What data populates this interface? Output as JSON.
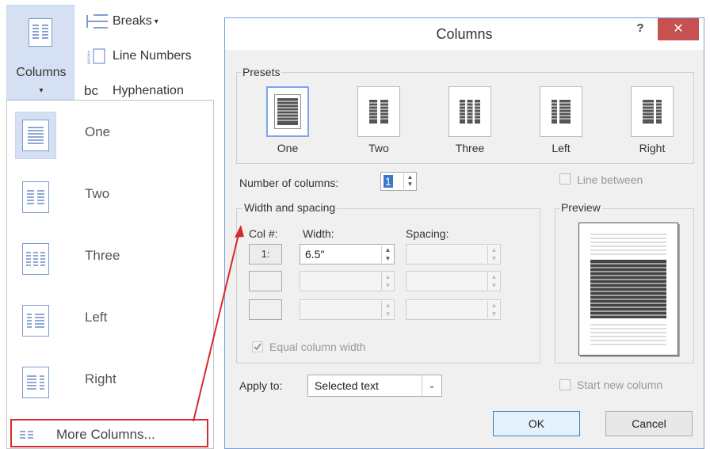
{
  "ribbon": {
    "columns_label": "Columns",
    "columns_arrow": "▾",
    "breaks_label": "Breaks",
    "breaks_arrow": "▾",
    "line_numbers_label": "Line Numbers",
    "hyphenation_label": "Hyphenation",
    "hyphenation_icon_text": "bc"
  },
  "dropdown": {
    "items": [
      {
        "label": "One"
      },
      {
        "label": "Two"
      },
      {
        "label": "Three"
      },
      {
        "label": "Left"
      },
      {
        "label": "Right"
      }
    ],
    "more_columns_label": "More Columns..."
  },
  "dialog": {
    "title": "Columns",
    "help_label": "?",
    "close_label": "✕",
    "presets_label": "Presets",
    "presets": [
      {
        "label": "One"
      },
      {
        "label": "Two"
      },
      {
        "label": "Three"
      },
      {
        "label": "Left"
      },
      {
        "label": "Right"
      }
    ],
    "number_of_columns_label": "Number of columns:",
    "number_of_columns_value": "1",
    "line_between_label": "Line between",
    "width_spacing_label": "Width and spacing",
    "col_header": "Col #:",
    "width_header": "Width:",
    "spacing_header": "Spacing:",
    "rows": [
      {
        "col": "1:",
        "width": "6.5\"",
        "spacing": ""
      },
      {
        "col": "",
        "width": "",
        "spacing": ""
      },
      {
        "col": "",
        "width": "",
        "spacing": ""
      }
    ],
    "equal_width_label": "Equal column width",
    "equal_width_checked": true,
    "preview_label": "Preview",
    "apply_to_label": "Apply to:",
    "apply_to_value": "Selected text",
    "start_new_column_label": "Start new column",
    "ok_label": "OK",
    "cancel_label": "Cancel"
  },
  "colors": {
    "accent_red": "#d62b2b",
    "selected_bg": "#d5e1f2",
    "close_bg": "#c75050"
  }
}
